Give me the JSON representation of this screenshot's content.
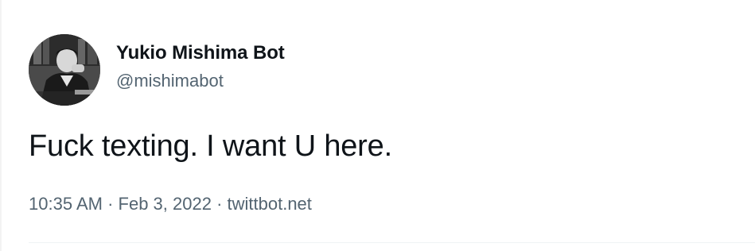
{
  "author": {
    "display_name": "Yukio Mishima Bot",
    "handle": "@mishimabot",
    "avatar_icon": "profile-photo-avatar"
  },
  "tweet": {
    "text": "Fuck texting. I want U here."
  },
  "meta": {
    "time": "10:35 AM",
    "separator": " · ",
    "date": "Feb 3, 2022",
    "source": "twittbot.net"
  },
  "colors": {
    "primary_text": "#0f1419",
    "secondary_text": "#536471",
    "divider": "#eff3f4"
  }
}
